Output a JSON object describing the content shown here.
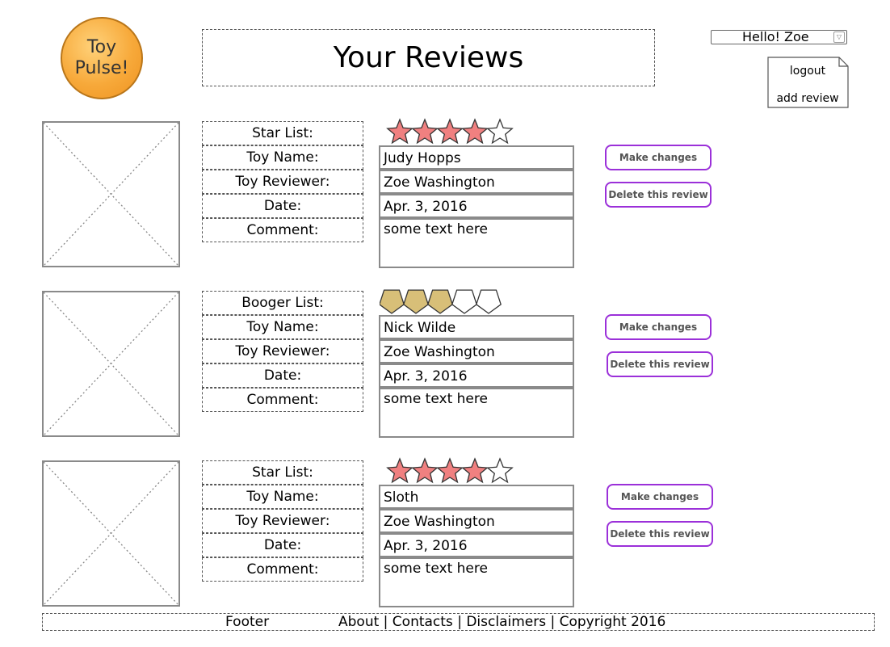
{
  "logo": {
    "line1": "Toy",
    "line2": "Pulse!"
  },
  "title": "Your Reviews",
  "user_dropdown": {
    "greeting": "Hello! Zoe",
    "arrow_icon": "chevron-down-icon"
  },
  "menu": {
    "logout": "logout",
    "add_review": "add review"
  },
  "reviews": [
    {
      "rating_label": "Star List:",
      "rating_icon": "star",
      "rating": 4,
      "rating_max": 5,
      "labels": {
        "toy_name": "Toy Name:",
        "reviewer": "Toy Reviewer:",
        "date": "Date:",
        "comment": "Comment:"
      },
      "toy_name": "Judy Hopps",
      "reviewer": "Zoe Washington",
      "date": "Apr. 3, 2016",
      "comment": "some text here",
      "make_changes": "Make changes",
      "delete": "Delete this review"
    },
    {
      "rating_label": "Booger List:",
      "rating_icon": "pentagon",
      "rating": 3,
      "rating_max": 5,
      "labels": {
        "toy_name": "Toy Name:",
        "reviewer": "Toy Reviewer:",
        "date": "Date:",
        "comment": "Comment:"
      },
      "toy_name": "Nick Wilde",
      "reviewer": "Zoe Washington",
      "date": "Apr. 3, 2016",
      "comment": "some text here",
      "make_changes": "Make changes",
      "delete": "Delete this review"
    },
    {
      "rating_label": "Star List:",
      "rating_icon": "star",
      "rating": 4,
      "rating_max": 5,
      "labels": {
        "toy_name": "Toy Name:",
        "reviewer": "Toy Reviewer:",
        "date": "Date:",
        "comment": "Comment:"
      },
      "toy_name": "Sloth",
      "reviewer": "Zoe Washington",
      "date": "Apr. 3, 2016",
      "comment": "some text here",
      "make_changes": "Make changes",
      "delete": "Delete this review"
    }
  ],
  "footer": {
    "label": "Footer",
    "links": "About | Contacts | Disclaimers | Copyright 2016"
  },
  "colors": {
    "star_fill": "#f08080",
    "booger_fill": "#d8bf78",
    "button_border": "#9b30d9",
    "logo": "#f7a93a"
  }
}
